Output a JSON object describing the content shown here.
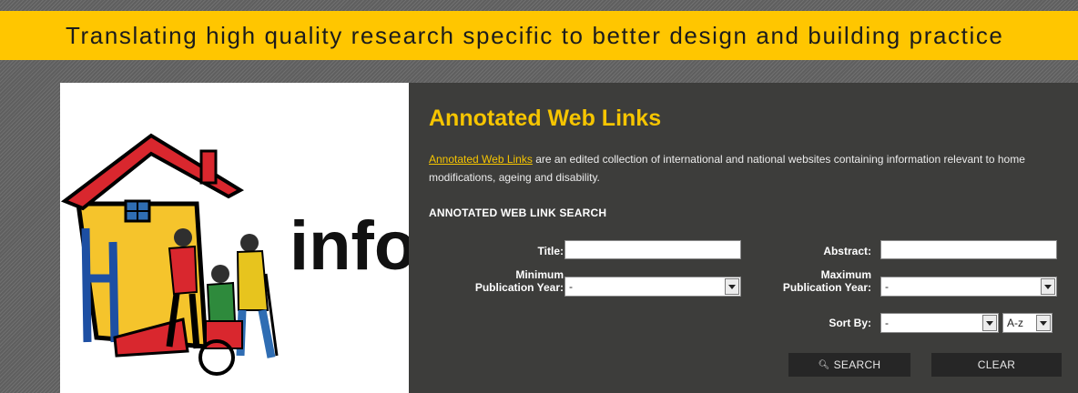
{
  "banner": {
    "tagline": "Translating high quality research specific to better design and building practice"
  },
  "logo": {
    "text": "info"
  },
  "panel": {
    "heading": "Annotated Web Links",
    "intro_link": "Annotated Web Links",
    "intro_text": " are an edited collection of international and national websites containing information relevant to home modifications, ageing and disability.",
    "search_heading": "ANNOTATED WEB LINK SEARCH"
  },
  "form": {
    "title_label": "Title:",
    "title_value": "",
    "abstract_label": "Abstract:",
    "abstract_value": "",
    "min_year_label_1": "Minimum",
    "min_year_label_2": "Publication Year:",
    "min_year_value": "-",
    "max_year_label_1": "Maximum",
    "max_year_label_2": "Publication Year:",
    "max_year_value": "-",
    "sort_label": "Sort By:",
    "sort_value": "-",
    "sort_order_value": "A-z"
  },
  "buttons": {
    "search": "SEARCH",
    "clear": "CLEAR"
  },
  "colors": {
    "banner": "#ffc600",
    "accent": "#f6c500",
    "panel": "#3d3d3b"
  }
}
